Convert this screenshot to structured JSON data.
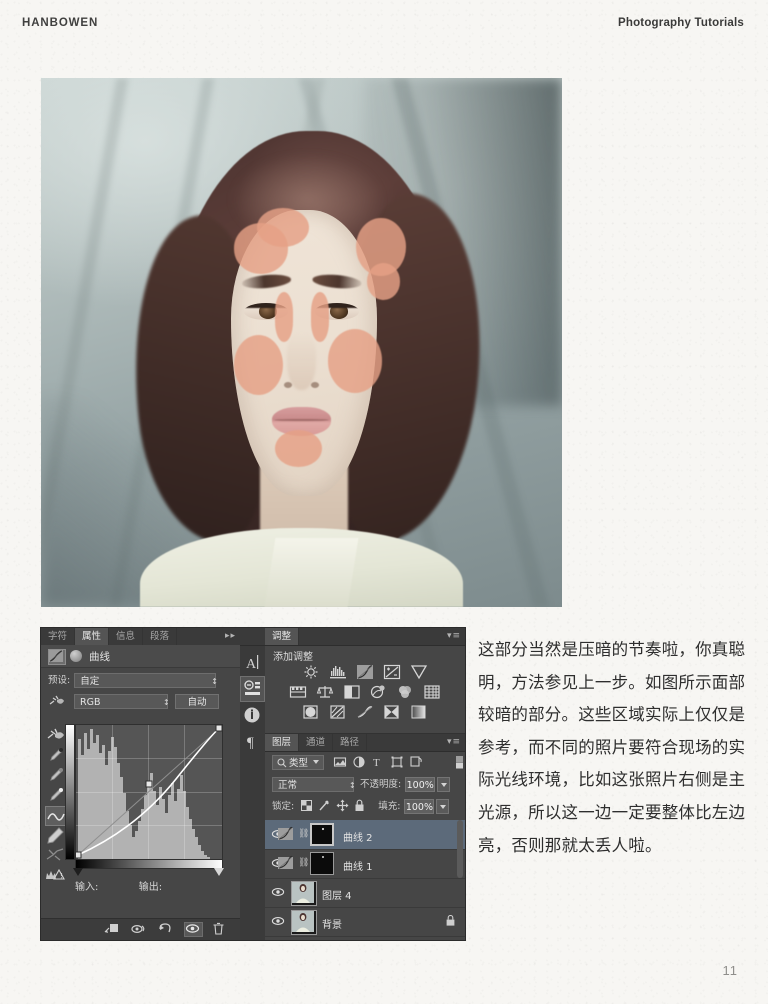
{
  "header": {
    "brand": "HANBOWEN",
    "section": "Photography Tutorials"
  },
  "page_number": "11",
  "photo": {
    "alt_description": "正面人像照片，面部标注压暗区域",
    "overlay_color": "#e6a186",
    "background_color": "#9aa6a6",
    "hair_color": "#4b3330",
    "skin_color": "#efe4d7"
  },
  "body_text": "这部分当然是压暗的节奏啦，你真聪明，方法参见上一步。如图所示面部较暗的部分。这些区域实际上仅仅是参考，而不同的照片要符合现场的实际光线环境，比如这张照片右侧是主光源，所以这一边一定要整体比左边亮，否则那就太丢人啦。",
  "photoshop": {
    "properties_panel": {
      "tabs": [
        {
          "label": "字符",
          "active": false
        },
        {
          "label": "属性",
          "active": true
        },
        {
          "label": "信息",
          "active": false
        },
        {
          "label": "段落",
          "active": false
        }
      ],
      "collapse_icon": "▸▸",
      "menu_icon": "▾≡",
      "title": "曲线",
      "preset_label": "预设:",
      "preset_value": "自定",
      "channel_value": "RGB",
      "auto_label": "自动",
      "input_label": "输入:",
      "output_label": "输出:",
      "input_value": "",
      "output_value": "",
      "tools": [
        "hand-adjust-icon",
        "eyedropper-black-icon",
        "eyedropper-gray-icon",
        "eyedropper-white-icon",
        "curve-pencil-icon",
        "pencil-icon",
        "smooth-curve-icon",
        "clipping-warning-icon"
      ],
      "selected_tool": "curve-pencil-icon",
      "footer_icons": [
        "clip-to-layer-icon",
        "previous-state-icon",
        "reset-icon",
        "toggle-visibility-icon",
        "delete-icon"
      ],
      "footer_active": "toggle-visibility-icon"
    },
    "icon_dock": [
      {
        "name": "character-tool-icon",
        "glyph": "A",
        "active": false
      },
      {
        "name": "adjustments-tool-icon",
        "glyph": "",
        "active": true
      },
      {
        "name": "info-tool-icon",
        "glyph": "i",
        "active": false
      },
      {
        "name": "paragraph-tool-icon",
        "glyph": "¶",
        "active": false
      }
    ],
    "adjustments_panel": {
      "title": "调整",
      "menu_icon": "▾≡",
      "subtitle": "添加调整",
      "rows": [
        [
          "brightness-contrast-icon",
          "levels-icon",
          "curves-icon",
          "exposure-icon",
          "vibrance-icon"
        ],
        [
          "hue-saturation-icon",
          "color-balance-icon",
          "black-white-icon",
          "photo-filter-icon",
          "channel-mixer-icon",
          "color-lookup-icon"
        ],
        [
          "invert-icon",
          "posterize-icon",
          "threshold-icon",
          "selective-color-icon",
          "gradient-map-icon"
        ]
      ]
    },
    "layers_panel": {
      "tabs": [
        {
          "label": "图层",
          "active": true
        },
        {
          "label": "通道",
          "active": false
        },
        {
          "label": "路径",
          "active": false
        }
      ],
      "menu_icon": "▾≡",
      "filter_label": "类型",
      "filter_icons": [
        "pixel-filter-icon",
        "adjustment-filter-icon",
        "type-filter-icon",
        "shape-filter-icon",
        "smart-object-filter-icon"
      ],
      "blend_mode": "正常",
      "opacity_label": "不透明度:",
      "opacity_value": "100%",
      "lock_label": "锁定:",
      "lock_icons": [
        "lock-transparent-icon",
        "lock-image-icon",
        "lock-position-icon",
        "lock-all-icon"
      ],
      "fill_label": "填充:",
      "fill_value": "100%",
      "layers": [
        {
          "name": "曲线 2",
          "type": "adjustment",
          "selected": true,
          "visible": true,
          "locked": false
        },
        {
          "name": "曲线 1",
          "type": "adjustment",
          "selected": false,
          "visible": true,
          "locked": false
        },
        {
          "name": "图层 4",
          "type": "pixel",
          "selected": false,
          "visible": true,
          "locked": false
        },
        {
          "name": "背景",
          "type": "pixel",
          "selected": false,
          "visible": true,
          "locked": true
        }
      ]
    }
  }
}
